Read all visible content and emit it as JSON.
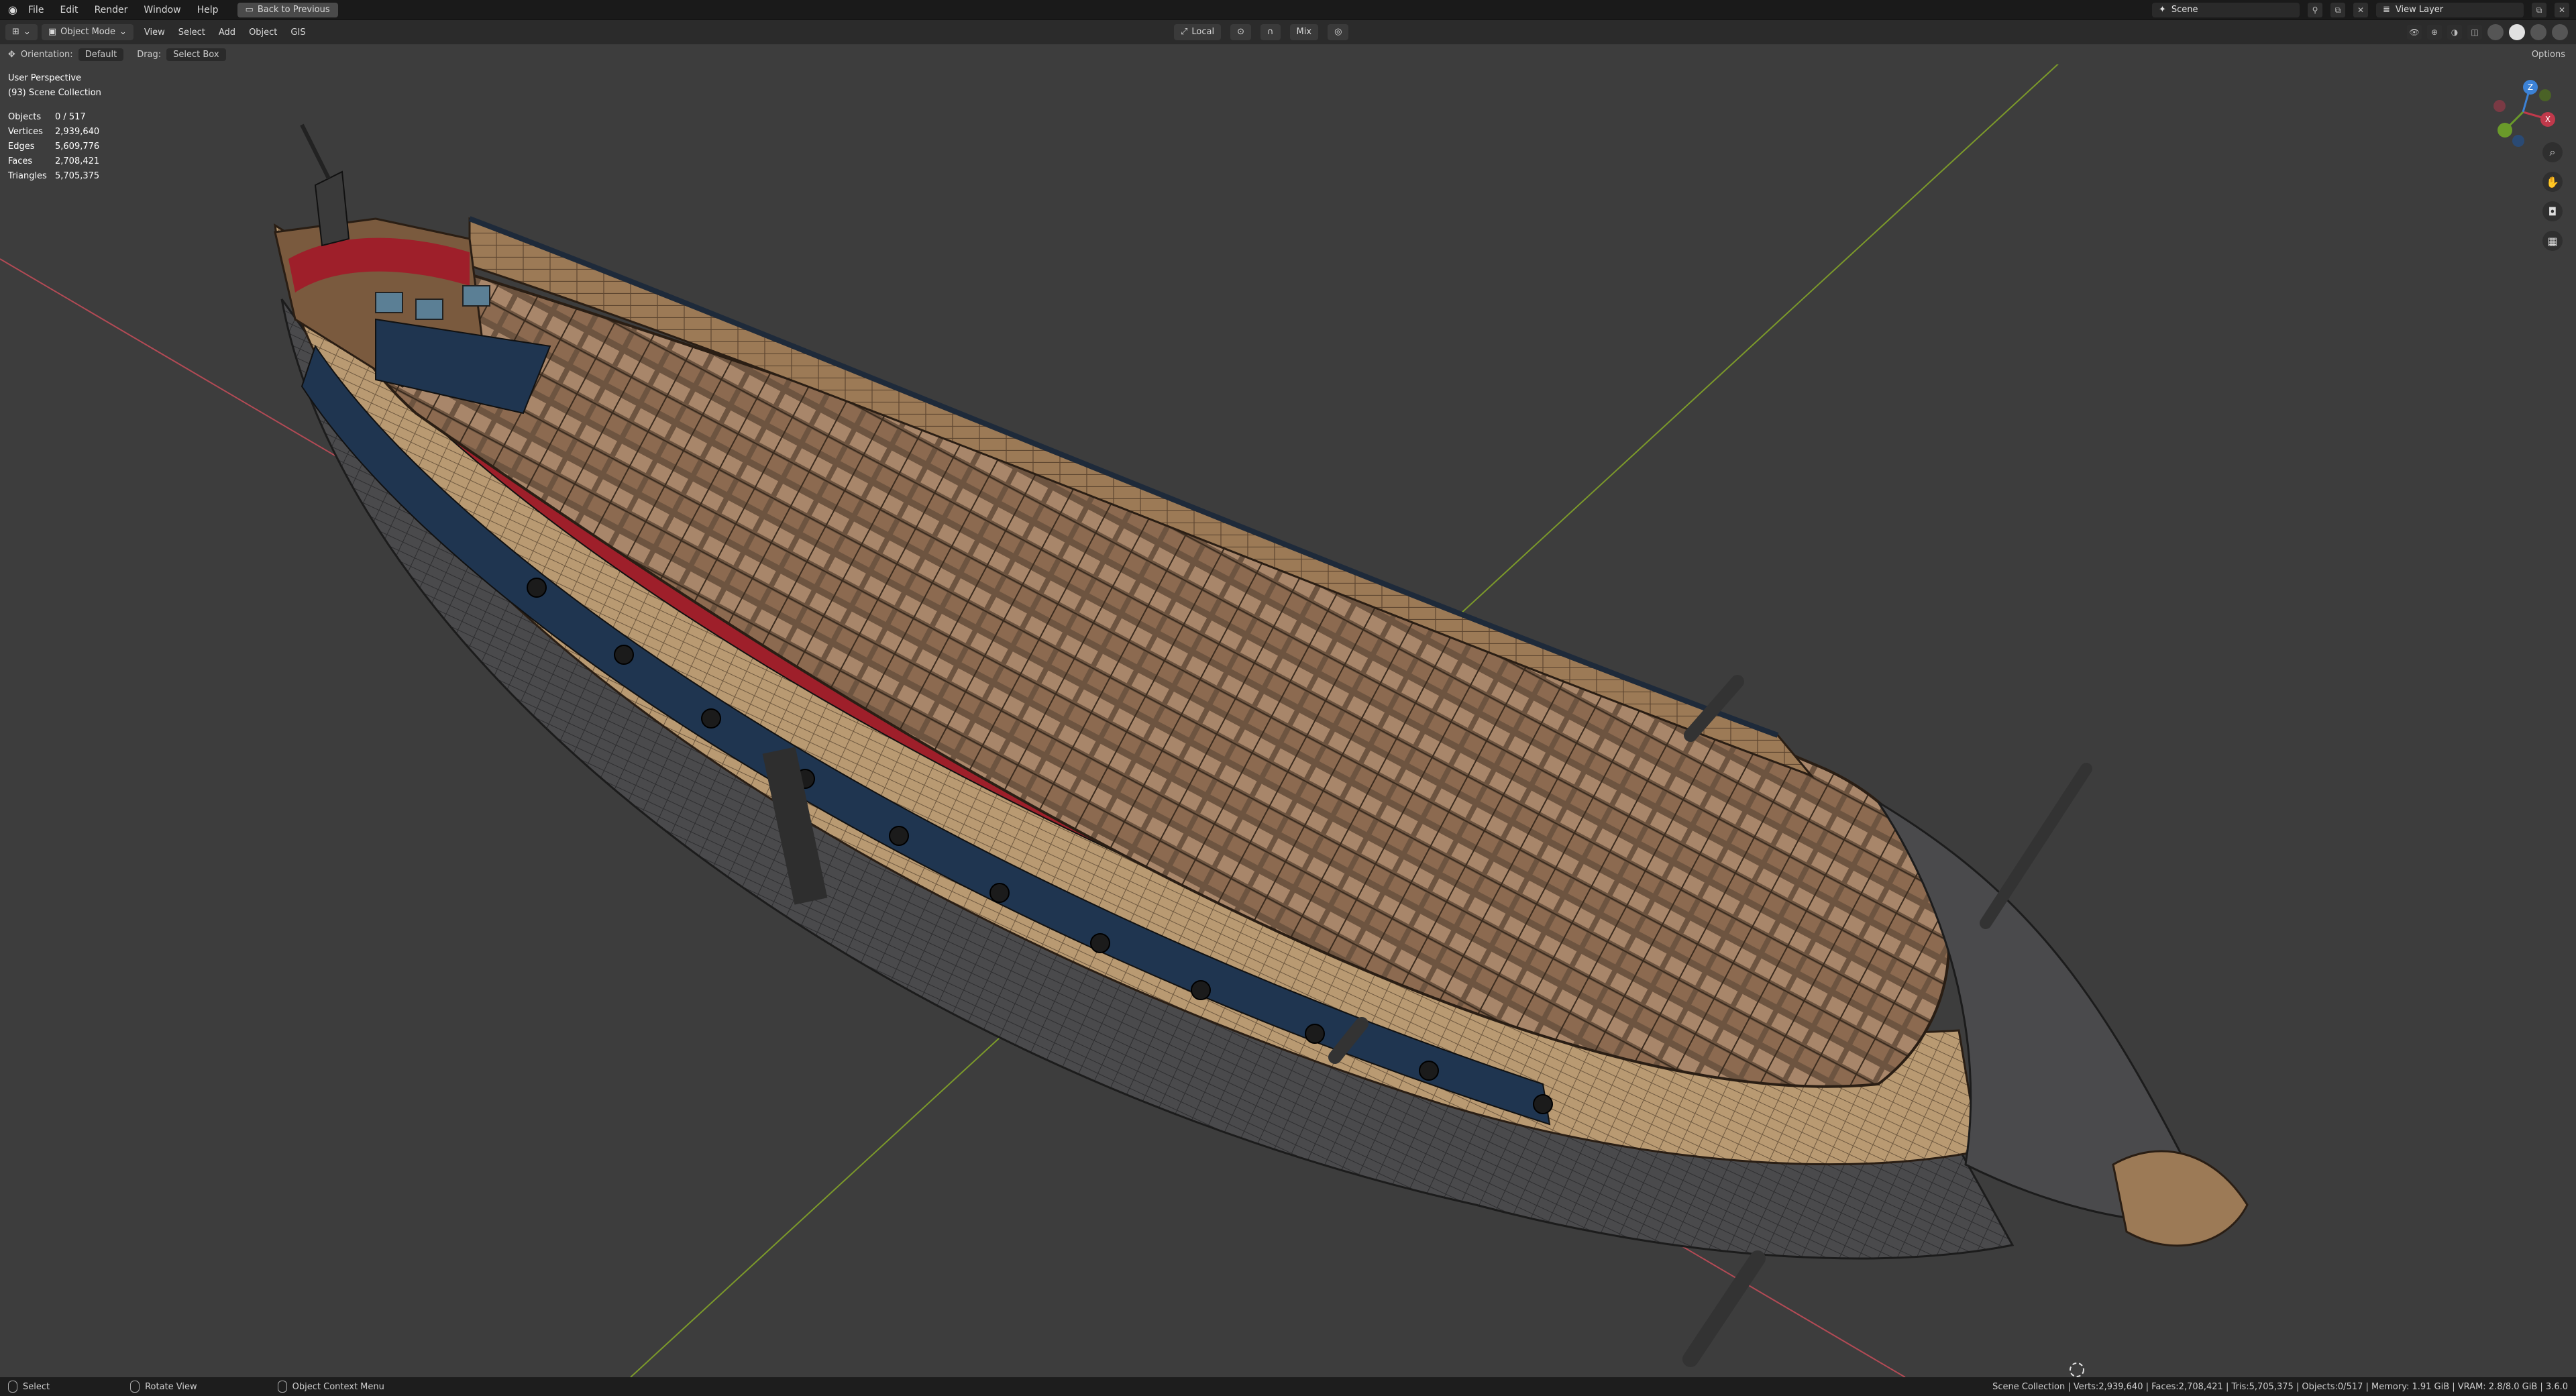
{
  "menubar": {
    "items": [
      "File",
      "Edit",
      "Render",
      "Window",
      "Help"
    ],
    "back_button": "Back to Previous",
    "scene": "Scene",
    "view_layer": "View Layer"
  },
  "viewport_header": {
    "mode": "Object Mode",
    "menus": [
      "View",
      "Select",
      "Add",
      "Object",
      "GIS"
    ],
    "transform": "Local",
    "snap": "Mix"
  },
  "tool_header": {
    "orientation_label": "Orientation:",
    "orientation_value": "Default",
    "drag_label": "Drag:",
    "drag_value": "Select Box",
    "options": "Options"
  },
  "overlay": {
    "view_name": "User Perspective",
    "collection": "(93) Scene Collection",
    "stats": [
      {
        "k": "Objects",
        "v": "0 / 517"
      },
      {
        "k": "Vertices",
        "v": "2,939,640"
      },
      {
        "k": "Edges",
        "v": "5,609,776"
      },
      {
        "k": "Faces",
        "v": "2,708,421"
      },
      {
        "k": "Triangles",
        "v": "5,705,375"
      }
    ]
  },
  "gizmo": {
    "x": "X",
    "y": "Y",
    "z": "Z"
  },
  "statusbar": {
    "select": "Select",
    "rotate": "Rotate View",
    "context": "Object Context Menu",
    "info": "Scene Collection | Verts:2,939,640 | Faces:2,708,421 | Tris:5,705,375 | Objects:0/517 | Memory: 1.91 GiB | VRAM: 2.8/8.0 GiB | 3.6.0"
  },
  "colors": {
    "background": "#3d3d3d",
    "x_axis": "#b34a55",
    "y_axis": "#7c9a2a",
    "hull_wood": "#9c7a56",
    "hull_red": "#9e1f2a",
    "hull_blue": "#1f3550"
  }
}
